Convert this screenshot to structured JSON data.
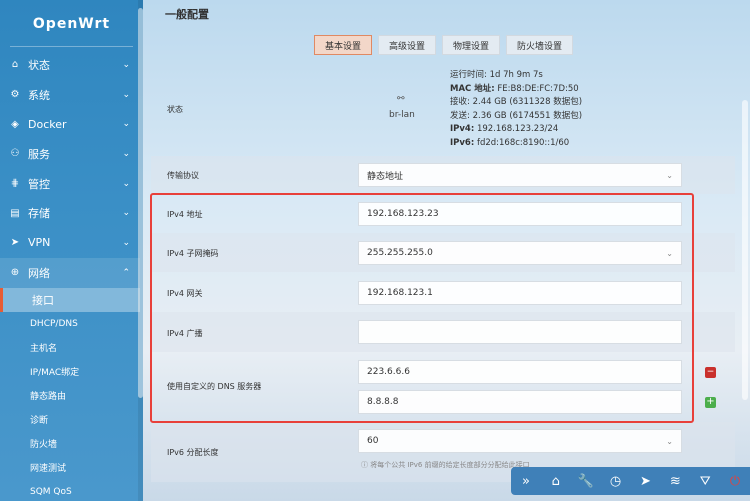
{
  "brand": "OpenWrt",
  "sidebar": {
    "items": [
      {
        "label": "状态",
        "icon": "home-icon",
        "glyph": "⌂"
      },
      {
        "label": "系统",
        "icon": "gear-icon",
        "glyph": "⚙"
      },
      {
        "label": "Docker",
        "icon": "docker-icon",
        "glyph": "◈"
      },
      {
        "label": "服务",
        "icon": "services-icon",
        "glyph": "⚇"
      },
      {
        "label": "管控",
        "icon": "control-icon",
        "glyph": "⋕"
      },
      {
        "label": "存储",
        "icon": "storage-icon",
        "glyph": "▤"
      },
      {
        "label": "VPN",
        "icon": "vpn-icon",
        "glyph": "➤"
      },
      {
        "label": "网络",
        "icon": "network-icon",
        "glyph": "⊕"
      }
    ],
    "network_sub": [
      {
        "label": "接口",
        "active": true
      },
      {
        "label": "DHCP/DNS"
      },
      {
        "label": "主机名"
      },
      {
        "label": "IP/MAC绑定"
      },
      {
        "label": "静态路由"
      },
      {
        "label": "诊断"
      },
      {
        "label": "防火墙"
      },
      {
        "label": "网速测试"
      },
      {
        "label": "SQM QoS"
      }
    ]
  },
  "main": {
    "section_title": "一般配置",
    "tabs": [
      "基本设置",
      "高级设置",
      "物理设置",
      "防火墙设置"
    ],
    "status": {
      "label": "状态",
      "iface": "br-lan",
      "lines": [
        {
          "k": "运行时间:",
          "v": "1d 7h 9m 7s"
        },
        {
          "k": "MAC 地址:",
          "v": "FE:B8:DE:FC:7D:50"
        },
        {
          "k": "接收:",
          "v": "2.44 GB (6311328 数据包)"
        },
        {
          "k": "发送:",
          "v": "2.36 GB (6174551 数据包)"
        },
        {
          "k": "IPv4:",
          "v": "192.168.123.23/24"
        },
        {
          "k": "IPv6:",
          "v": "fd2d:168c:8190::1/60"
        }
      ]
    },
    "protocol": {
      "label": "传输协议",
      "value": "静态地址"
    },
    "ipv4_addr": {
      "label": "IPv4 地址",
      "value": "192.168.123.23"
    },
    "ipv4_mask": {
      "label": "IPv4 子网掩码",
      "value": "255.255.255.0"
    },
    "ipv4_gw": {
      "label": "IPv4 网关",
      "value": "192.168.123.1"
    },
    "ipv4_bcast": {
      "label": "IPv4 广播",
      "value": ""
    },
    "dns": {
      "label": "使用自定义的 DNS 服务器",
      "values": [
        "223.6.6.6",
        "8.8.8.8"
      ]
    },
    "ipv6_len": {
      "label": "IPv6 分配长度",
      "value": "60",
      "hint": "将每个公共 IPv6 前缀的给定长度部分分配给此接口"
    }
  },
  "toolbar": [
    "»",
    "⌂",
    "🔧",
    "◷",
    "➤",
    "≋",
    "⛛",
    "⏻"
  ]
}
